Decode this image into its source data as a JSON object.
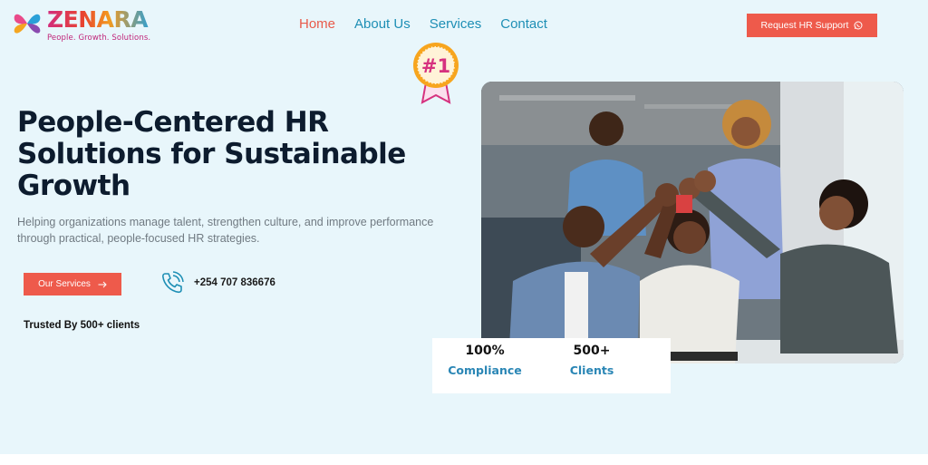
{
  "brand": {
    "name": "ZENARA",
    "tagline": "People. Growth. Solutions."
  },
  "nav": {
    "items": [
      {
        "label": "Home",
        "active": true
      },
      {
        "label": "About Us",
        "active": false
      },
      {
        "label": "Services",
        "active": false
      },
      {
        "label": "Contact",
        "active": false
      }
    ]
  },
  "header": {
    "cta_label": "Request HR Support",
    "cta_icon": "whatsapp-icon"
  },
  "badge": {
    "text": "#1",
    "icon": "award-ribbon-icon"
  },
  "hero": {
    "title": "People-Centered HR Solutions for Sustainable Growth",
    "subtitle": "Helping organizations manage talent, strengthen culture, and improve performance through practical, people-focused HR strategies.",
    "services_button": "Our Services",
    "services_button_icon": "arrow-right-icon",
    "phone_icon": "phone-ringing-icon",
    "phone": "+254 707 836676",
    "trusted": "Trusted By 500+ clients"
  },
  "stats": [
    {
      "value": "100%",
      "label": "Compliance"
    },
    {
      "value": "500+",
      "label": "Clients"
    }
  ],
  "colors": {
    "background": "#e8f6fb",
    "accent": "#ee5a4b",
    "link": "#1e8fb5",
    "heading": "#0d1c2e",
    "stat_label": "#2a86b5"
  }
}
